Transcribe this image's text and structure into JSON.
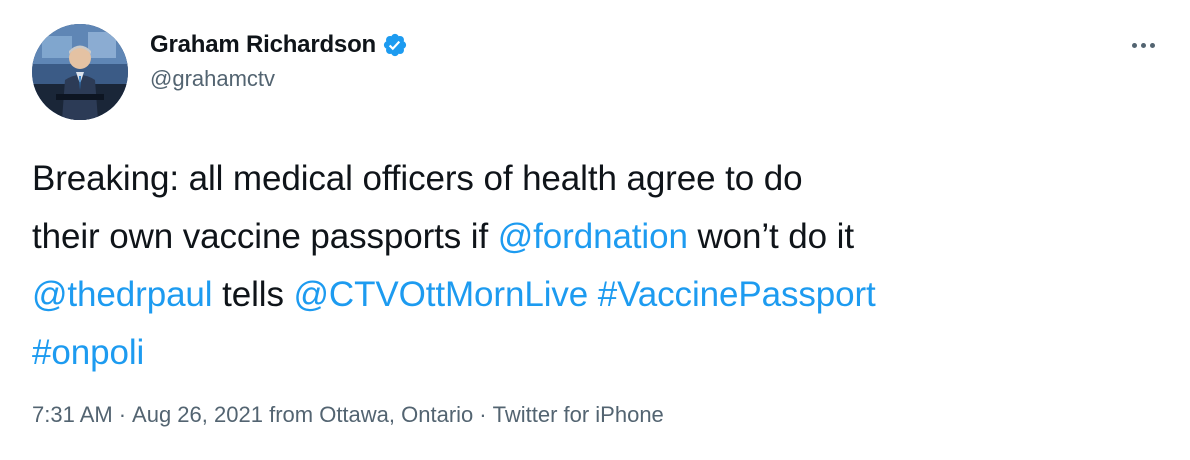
{
  "author": {
    "display_name": "Graham Richardson",
    "handle": "@grahamctv",
    "verified": true
  },
  "icons": {
    "avatar": "profile-photo",
    "verified": "verified-badge-icon",
    "more": "more-options-icon"
  },
  "colors": {
    "text": "#0f1419",
    "secondary": "#536471",
    "link": "#1d9bf0"
  },
  "tweet": {
    "lines": [
      [
        {
          "text": "Breaking: all medical officers of health agree to do",
          "link": false
        }
      ],
      [
        {
          "text": "their own vaccine passports if ",
          "link": false
        },
        {
          "text": "@fordnation",
          "link": true
        },
        {
          "text": " won’t do it",
          "link": false
        }
      ],
      [
        {
          "text": "@thedrpaul",
          "link": true
        },
        {
          "text": " tells ",
          "link": false
        },
        {
          "text": "@CTVOttMornLive",
          "link": true
        },
        {
          "text": " ",
          "link": false
        },
        {
          "text": "#VaccinePassport",
          "link": true
        }
      ],
      [
        {
          "text": "#onpoli",
          "link": true
        }
      ]
    ]
  },
  "meta": {
    "time": "7:31 AM",
    "date": "Aug 26, 2021",
    "location_prefix": "from ",
    "location": "Ottawa, Ontario",
    "source": "Twitter for iPhone",
    "separator": "·"
  }
}
